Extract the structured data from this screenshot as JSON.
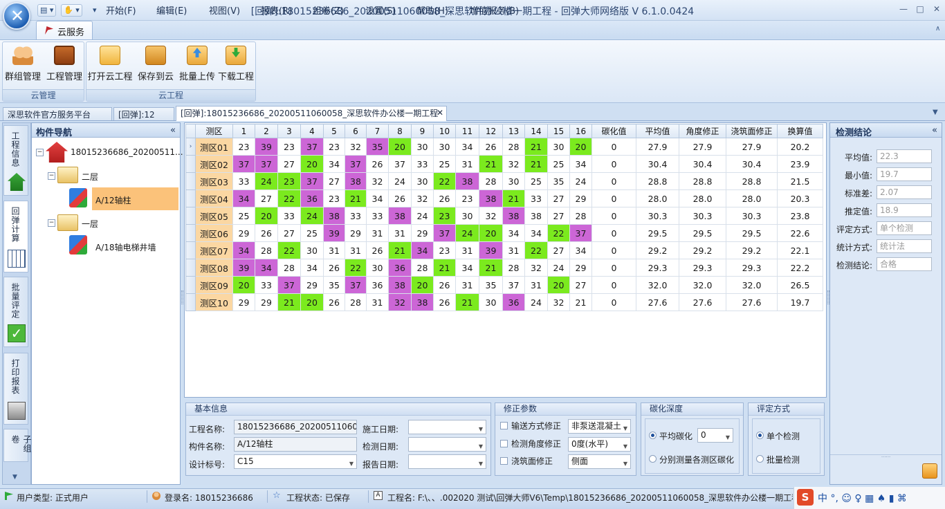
{
  "window": {
    "title": "[回弹]:18015236686_20200511060058_深思软件办公楼一期工程 - 回弹大师网络版 V 6.1.0.0424",
    "quick_access": [
      "▾",
      "▾",
      "▾"
    ]
  },
  "menu": {
    "items": [
      "云服务",
      "开始(F)",
      "编辑(E)",
      "视图(V)",
      "报表(R)",
      "组卷(Z)",
      "设置(S)",
      "帮助(H)",
      "增值服务(B)"
    ]
  },
  "ribbon": {
    "groups": [
      {
        "label": "云管理",
        "buttons": [
          "群组管理",
          "工程管理"
        ]
      },
      {
        "label": "云工程",
        "buttons": [
          "打开云工程",
          "保存到云",
          "批量上传",
          "下载工程"
        ]
      }
    ]
  },
  "doc_tabs": [
    "深思软件官方服务平台",
    "[回弹]:12",
    "[回弹]:18015236686_20200511060058_深思软件办公楼一期工程"
  ],
  "side_tabs": [
    "工程信息",
    "回弹计算",
    "批量评定",
    "打印报表",
    "子组卷"
  ],
  "nav": {
    "title": "构件导航",
    "collapse": "«",
    "root": "18015236686_20200511...",
    "floor2": "二层",
    "member1": "A/12轴柱",
    "floor1": "一层",
    "member2": "A/18轴电梯井墙"
  },
  "grid": {
    "headers": [
      "测区",
      "1",
      "2",
      "3",
      "4",
      "5",
      "6",
      "7",
      "8",
      "9",
      "10",
      "11",
      "12",
      "13",
      "14",
      "15",
      "16",
      "碳化值",
      "平均值",
      "角度修正",
      "浇筑面修正",
      "换算值"
    ],
    "rows": [
      {
        "area": "测区01",
        "v": [
          "23",
          "39",
          "23",
          "37",
          "23",
          "32",
          "35",
          "20",
          "30",
          "30",
          "34",
          "26",
          "28",
          "21",
          "30",
          "20"
        ],
        "mark": [
          "",
          "h",
          "",
          "h",
          "",
          "",
          "h",
          "l",
          "",
          "",
          "",
          "",
          "",
          "l",
          "",
          "l"
        ],
        "carb": "0",
        "avg": "27.9",
        "angle": "27.9",
        "pour": "27.9",
        "conv": "20.2"
      },
      {
        "area": "测区02",
        "v": [
          "37",
          "37",
          "27",
          "20",
          "34",
          "37",
          "26",
          "37",
          "33",
          "25",
          "31",
          "21",
          "32",
          "21",
          "25",
          "34"
        ],
        "mark": [
          "h",
          "h",
          "",
          "l",
          "",
          "h",
          "",
          "",
          "",
          "",
          "",
          "l",
          "",
          "l",
          "",
          ""
        ],
        "carb": "0",
        "avg": "30.4",
        "angle": "30.4",
        "pour": "30.4",
        "conv": "23.9"
      },
      {
        "area": "测区03",
        "v": [
          "33",
          "24",
          "23",
          "37",
          "27",
          "38",
          "32",
          "24",
          "30",
          "22",
          "38",
          "28",
          "30",
          "25",
          "35",
          "24"
        ],
        "mark": [
          "",
          "l",
          "l",
          "h",
          "",
          "h",
          "",
          "",
          "",
          "l",
          "h",
          "",
          "",
          "",
          "",
          ""
        ],
        "carb": "0",
        "avg": "28.8",
        "angle": "28.8",
        "pour": "28.8",
        "conv": "21.5"
      },
      {
        "area": "测区04",
        "v": [
          "34",
          "27",
          "22",
          "36",
          "23",
          "21",
          "34",
          "26",
          "32",
          "26",
          "23",
          "38",
          "21",
          "33",
          "27",
          "29"
        ],
        "mark": [
          "h",
          "",
          "l",
          "h",
          "",
          "l",
          "",
          "",
          "",
          "",
          "",
          "h",
          "l",
          "",
          "",
          ""
        ],
        "carb": "0",
        "avg": "28.0",
        "angle": "28.0",
        "pour": "28.0",
        "conv": "20.3"
      },
      {
        "area": "测区05",
        "v": [
          "25",
          "20",
          "33",
          "24",
          "38",
          "33",
          "33",
          "38",
          "24",
          "23",
          "30",
          "32",
          "38",
          "38",
          "27",
          "28"
        ],
        "mark": [
          "",
          "l",
          "",
          "l",
          "h",
          "",
          "",
          "h",
          "",
          "l",
          "",
          "",
          "h",
          "",
          "",
          ""
        ],
        "carb": "0",
        "avg": "30.3",
        "angle": "30.3",
        "pour": "30.3",
        "conv": "23.8"
      },
      {
        "area": "测区06",
        "v": [
          "29",
          "26",
          "27",
          "25",
          "39",
          "29",
          "31",
          "31",
          "29",
          "37",
          "24",
          "20",
          "34",
          "34",
          "22",
          "37"
        ],
        "mark": [
          "",
          "",
          "",
          "",
          "h",
          "",
          "",
          "",
          "",
          "h",
          "l",
          "l",
          "",
          "",
          "l",
          "h"
        ],
        "carb": "0",
        "avg": "29.5",
        "angle": "29.5",
        "pour": "29.5",
        "conv": "22.6"
      },
      {
        "area": "测区07",
        "v": [
          "34",
          "28",
          "22",
          "30",
          "31",
          "31",
          "26",
          "21",
          "34",
          "23",
          "31",
          "39",
          "31",
          "22",
          "27",
          "34"
        ],
        "mark": [
          "h",
          "",
          "l",
          "",
          "",
          "",
          "",
          "l",
          "h",
          "",
          "",
          "h",
          "",
          "l",
          "",
          ""
        ],
        "carb": "0",
        "avg": "29.2",
        "angle": "29.2",
        "pour": "29.2",
        "conv": "22.1"
      },
      {
        "area": "测区08",
        "v": [
          "39",
          "34",
          "28",
          "34",
          "26",
          "22",
          "30",
          "36",
          "28",
          "21",
          "34",
          "21",
          "28",
          "32",
          "24",
          "29"
        ],
        "mark": [
          "h",
          "h",
          "",
          "",
          "",
          "l",
          "",
          "h",
          "",
          "l",
          "",
          "l",
          "",
          "",
          "",
          ""
        ],
        "carb": "0",
        "avg": "29.3",
        "angle": "29.3",
        "pour": "29.3",
        "conv": "22.2"
      },
      {
        "area": "测区09",
        "v": [
          "20",
          "33",
          "37",
          "29",
          "35",
          "37",
          "36",
          "38",
          "20",
          "26",
          "31",
          "35",
          "37",
          "31",
          "20",
          "27"
        ],
        "mark": [
          "l",
          "",
          "h",
          "",
          "",
          "h",
          "",
          "h",
          "l",
          "",
          "",
          "",
          "",
          "",
          "l",
          ""
        ],
        "carb": "0",
        "avg": "32.0",
        "angle": "32.0",
        "pour": "32.0",
        "conv": "26.5"
      },
      {
        "area": "测区10",
        "v": [
          "29",
          "29",
          "21",
          "20",
          "26",
          "28",
          "31",
          "32",
          "38",
          "26",
          "21",
          "30",
          "36",
          "24",
          "32",
          "21"
        ],
        "mark": [
          "",
          "",
          "l",
          "l",
          "",
          "",
          "",
          "h",
          "h",
          "",
          "l",
          "",
          "h",
          "",
          "",
          ""
        ],
        "carb": "0",
        "avg": "27.6",
        "angle": "27.6",
        "pour": "27.6",
        "conv": "19.7"
      }
    ]
  },
  "basic_info": {
    "title": "基本信息",
    "project_label": "工程名称:",
    "project_value": "18015236686_2020051106005",
    "member_label": "构件名称:",
    "member_value": "A/12轴柱",
    "grade_label": "设计标号:",
    "grade_value": "C15",
    "build_date_label": "施工日期:",
    "test_date_label": "检测日期:",
    "report_date_label": "报告日期:"
  },
  "correction": {
    "title": "修正参数",
    "pump_label": "输送方式修正",
    "pump_value": "非泵送混凝土",
    "angle_label": "检测角度修正",
    "angle_value": "0度(水平)",
    "pour_label": "浇筑面修正",
    "pour_value": "侧面"
  },
  "carbonation": {
    "title": "碳化深度",
    "avg_label": "平均碳化",
    "avg_value": "0",
    "each_label": "分别测量各测区碳化"
  },
  "evaluation": {
    "title": "评定方式",
    "single_label": "单个检测",
    "batch_label": "批量检测"
  },
  "conclusion": {
    "title": "检测结论",
    "collapse": "«",
    "fields": [
      {
        "label": "平均值:",
        "value": "22.3"
      },
      {
        "label": "最小值:",
        "value": "19.7"
      },
      {
        "label": "标准差:",
        "value": "2.07"
      },
      {
        "label": "推定值:",
        "value": "18.9"
      },
      {
        "label": "评定方式:",
        "value": "单个检测"
      },
      {
        "label": "统计方式:",
        "value": "统计法"
      },
      {
        "label": "检测结论:",
        "value": "合格"
      }
    ]
  },
  "status": {
    "user_type": "用户类型:  正式用户",
    "login": "登录名: 18015236686",
    "project_state": "工程状态: 已保存",
    "project_path": "工程名: F:\\、、.002020 测试\\回弹大师V6\\Temp\\18015236686_20200511060058_深思软件办公楼一期工程",
    "ime": "中 °, ☺ ♀ ▦ ♠ ▮ ⌘"
  },
  "colors": {
    "high": "#cc66d6",
    "low": "#7bea1e",
    "area_selected": "#fbd7a2"
  }
}
